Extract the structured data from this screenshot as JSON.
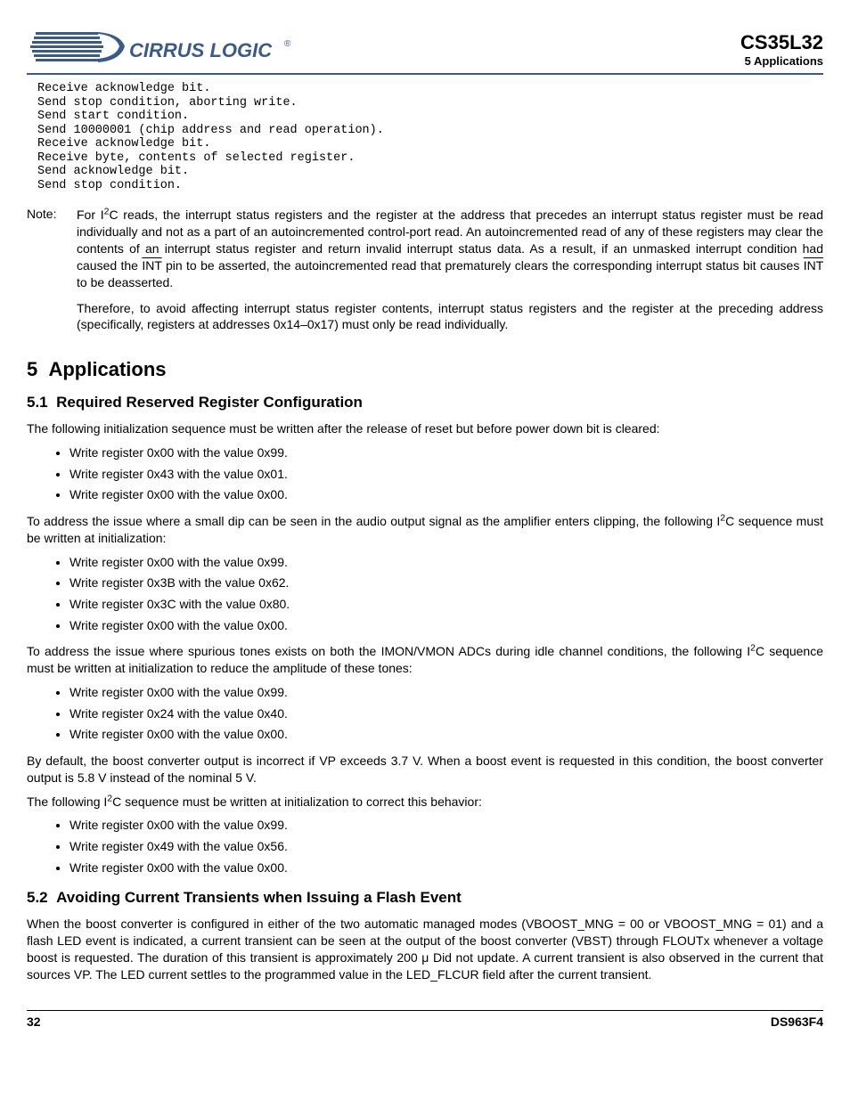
{
  "header": {
    "brand": "CIRRUS LOGIC",
    "part_number": "CS35L32",
    "section_ref": "5 Applications"
  },
  "code": {
    "lines": [
      "Receive acknowledge bit.",
      "Send stop condition, aborting write.",
      "Send start condition.",
      "Send 10000001 (chip address and read operation).",
      "Receive acknowledge bit.",
      "Receive byte, contents of selected register.",
      "Send acknowledge bit.",
      "Send stop condition."
    ]
  },
  "note": {
    "label": "Note:",
    "p1a": "For I",
    "p1b": "C reads, the interrupt status registers and the register at the address that precedes an interrupt status register must be read individually and not as a part of an autoincremented control-port read. An autoincremented read of any of these registers may clear the contents of an interrupt status register and return invalid interrupt status data. As a result, if an unmasked interrupt condition had caused the ",
    "int1": "INT",
    "p1c": " pin to be asserted, the autoincremented read that prematurely clears the corresponding interrupt status bit causes ",
    "int2": "INT",
    "p1d": " to be deasserted.",
    "p2": "Therefore, to avoid affecting interrupt status register contents, interrupt status registers and the register at the preceding address (specifically, registers at addresses 0x14–0x17) must only be read individually."
  },
  "sec5": {
    "number": "5",
    "title": "Applications"
  },
  "sec51": {
    "number": "5.1",
    "title": "Required Reserved Register Configuration",
    "intro": "The following initialization sequence must be written after the release of reset but before power down bit is cleared:",
    "list1": [
      "Write register 0x00 with the value 0x99.",
      "Write register 0x43 with the value 0x01.",
      "Write register 0x00 with the value 0x00."
    ],
    "para2a": "To address the issue where a small dip can be seen in the audio output signal as the amplifier enters clipping, the following I",
    "para2b": "C sequence must be written at initialization:",
    "list2": [
      "Write register 0x00 with the value 0x99.",
      "Write register 0x3B with the value 0x62.",
      "Write register 0x3C with the value 0x80.",
      "Write register 0x00 with the value 0x00."
    ],
    "para3a": "To address the issue where spurious tones exists on both the IMON/VMON ADCs during idle channel conditions, the following I",
    "para3b": "C sequence must be written at initialization to reduce the amplitude of these tones:",
    "list3": [
      "Write register 0x00 with the value 0x99.",
      "Write register 0x24 with the value 0x40.",
      "Write register 0x00 with the value 0x00."
    ],
    "para4": "By default, the boost converter output is incorrect if VP exceeds 3.7 V. When a boost event is requested in this condition, the boost converter output is 5.8 V instead of the nominal 5 V.",
    "para5a": "The following I",
    "para5b": "C sequence must be written at initialization to correct this behavior:",
    "list4": [
      "Write register 0x00 with the value 0x99.",
      "Write register 0x49 with the value 0x56.",
      "Write register 0x00 with the value 0x00."
    ]
  },
  "sec52": {
    "number": "5.2",
    "title": "Avoiding Current Transients when Issuing a Flash Event",
    "para": "When the boost converter is configured in either of the two automatic managed modes (VBOOST_MNG = 00 or VBOOST_MNG = 01) and a flash LED event is indicated, a current transient can be seen at the output of the boost converter (VBST) through FLOUTx whenever a voltage boost is requested. The duration of this transient is approximately 200 μ Did not update. A current transient is also observed in the current that sources VP. The LED current settles to the programmed value in the LED_FLCUR field after the current transient."
  },
  "footer": {
    "page": "32",
    "doc": "DS963F4"
  }
}
